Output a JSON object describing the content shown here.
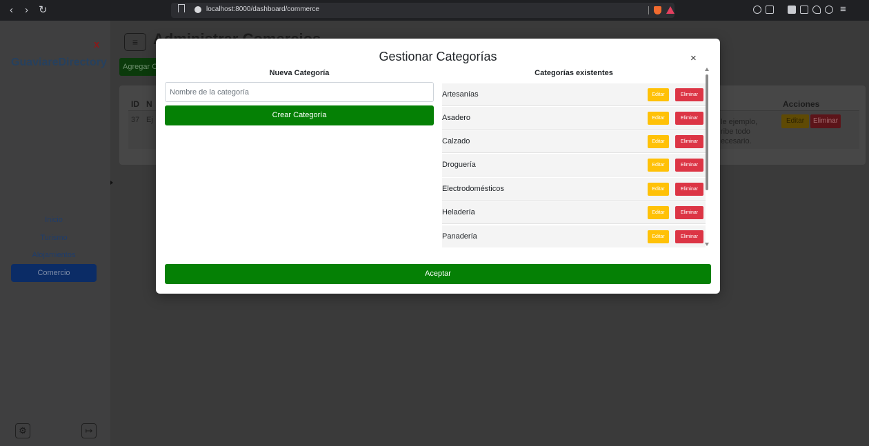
{
  "browser": {
    "url": "localhost:8000/dashboard/commerce"
  },
  "sidebar": {
    "close_label": "x",
    "brand": "GuaviareDirectory",
    "items": [
      {
        "label": "Inicio"
      },
      {
        "label": "Turismo"
      },
      {
        "label": "Alojamientos"
      },
      {
        "label": "Comercio",
        "active": true
      }
    ]
  },
  "background": {
    "page_title": "Administrar Comercios",
    "add_button": "Agregar C",
    "table_headers": {
      "id": "ID",
      "name": "N",
      "actions": "Acciones"
    },
    "row": {
      "id": "37",
      "name_fragment": "Ej",
      "description_fragment": [
        "le ejemplo,",
        "ribe todo",
        "ecesario."
      ],
      "edit": "Editar",
      "delete": "Eliminar"
    }
  },
  "modal": {
    "title": "Gestionar Categorías",
    "close_label": "×",
    "new_category_heading": "Nueva Categoría",
    "existing_heading": "Categorías existentes",
    "input_placeholder": "Nombre de la categoría",
    "create_button": "Crear Categoría",
    "accept_button": "Aceptar",
    "edit_label": "Editar",
    "delete_label": "Eliminar",
    "categories": [
      {
        "name": "Artesanías"
      },
      {
        "name": "Asadero"
      },
      {
        "name": "Calzado"
      },
      {
        "name": "Droguería"
      },
      {
        "name": "Electrodomésticos"
      },
      {
        "name": "Heladería"
      },
      {
        "name": "Panadería"
      }
    ]
  },
  "colors": {
    "primary_green": "#058005",
    "edit_yellow": "#ffc107",
    "delete_red": "#dc3545",
    "brand_blue": "#0d6efd"
  }
}
